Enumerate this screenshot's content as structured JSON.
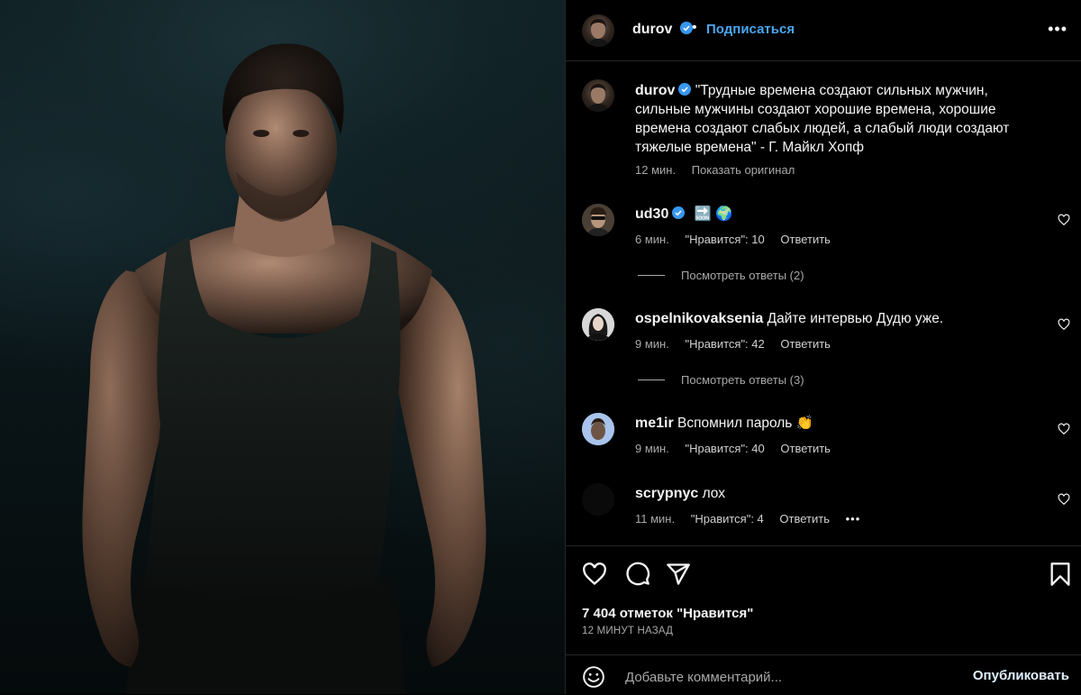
{
  "post_author": {
    "username": "durov",
    "verified": true,
    "follow_label": "Подписаться",
    "separator": "•"
  },
  "caption": {
    "username": "durov",
    "text": "\"Трудные времена создают сильных мужчин, сильные мужчины создают хорошие времена, хорошие времена создают слабых людей, а слабый люди создают тяжелые времена\" - Г. Майкл Хопф",
    "time": "12 мин.",
    "show_original_label": "Показать оригинал"
  },
  "comments": [
    {
      "username": "ud30",
      "verified": true,
      "text": "🔜 🌍",
      "time": "6 мин.",
      "likes_label": "\"Нравится\": 10",
      "reply_label": "Ответить",
      "view_replies_label": "Посмотреть ответы (2)"
    },
    {
      "username": "ospelnikovaksenia",
      "text": "Дайте интервью Дудю уже.",
      "time": "9 мин.",
      "likes_label": "\"Нравится\": 42",
      "reply_label": "Ответить",
      "view_replies_label": "Посмотреть ответы (3)"
    },
    {
      "username": "me1ir",
      "text": "Вспомнил пароль 👏",
      "time": "9 мин.",
      "likes_label": "\"Нравится\": 40",
      "reply_label": "Ответить"
    },
    {
      "username": "scrypnyc",
      "text": "лох",
      "time": "11 мин.",
      "likes_label": "\"Нравится\": 4",
      "reply_label": "Ответить",
      "more_label": "•••"
    }
  ],
  "header_more_label": "•••",
  "icons": [
    "heart-icon",
    "comment-icon",
    "share-icon",
    "bookmark-icon",
    "emoji-icon",
    "verified-icon",
    "more-icon"
  ],
  "likes_count_label": "7 404 отметок \"Нравится\"",
  "posted_time_label": "12 МИНУТ НАЗАД",
  "comment_input": {
    "placeholder": "Добавьте комментарий...",
    "value": ""
  },
  "publish_label": "Опубликовать",
  "colors": {
    "accent": "#4aa6ee",
    "muted": "#a8a8a8",
    "background": "#000000",
    "divider": "#262626"
  }
}
